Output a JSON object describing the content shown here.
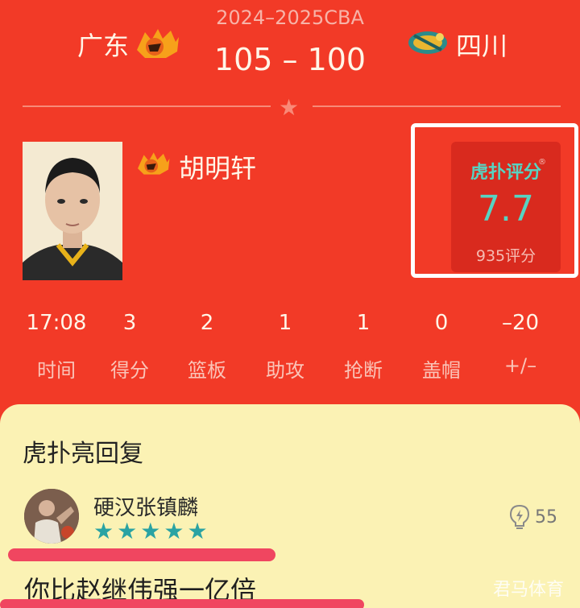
{
  "header": {
    "season": "2024–2025CBA",
    "home_team": "广东",
    "away_team": "四川",
    "score": "105 – 100",
    "home_logo_icon": "guangdong-tigers-logo",
    "away_logo_icon": "sichuan-logo"
  },
  "player": {
    "name": "胡明轩",
    "team_logo_icon": "guangdong-tigers-logo"
  },
  "rating": {
    "brand": "虎扑评分",
    "reg_mark": "®",
    "value": "7.7",
    "count": "935评分"
  },
  "stats": [
    {
      "value": "17:08",
      "label": "时间"
    },
    {
      "value": "3",
      "label": "得分"
    },
    {
      "value": "2",
      "label": "篮板"
    },
    {
      "value": "1",
      "label": "助攻"
    },
    {
      "value": "1",
      "label": "抢断"
    },
    {
      "value": "0",
      "label": "盖帽"
    },
    {
      "value": "–20",
      "label": "+/–"
    }
  ],
  "reply": {
    "title": "虎扑亮回复",
    "username": "硬汉张镇麟",
    "stars": 5,
    "likes": "55",
    "content": "你比赵继伟强一亿倍"
  },
  "watermark": "君马体育",
  "colors": {
    "background": "#f23a27",
    "rating_accent": "#57d3c2",
    "star_color": "#2aa3a3",
    "highlight": "#f04660",
    "panel": "#fbf2b4"
  }
}
